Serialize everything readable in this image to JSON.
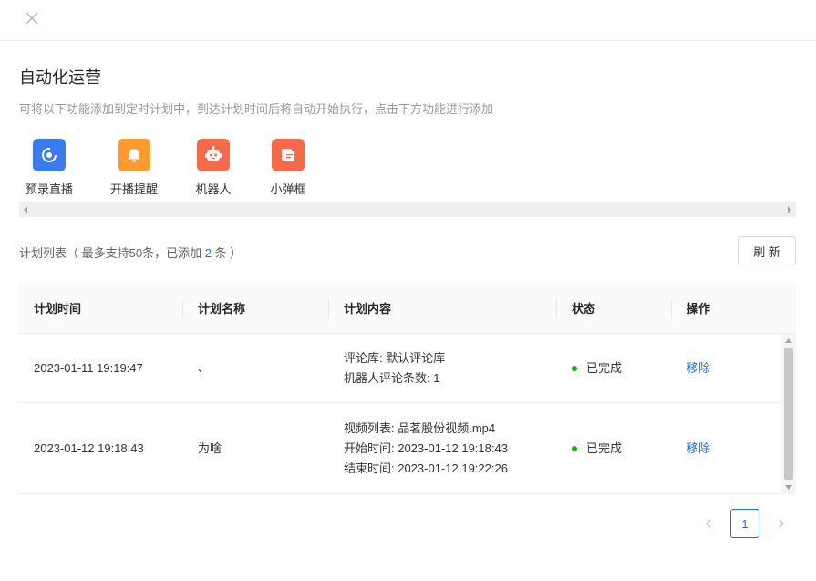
{
  "header": {
    "close_label": "×"
  },
  "section": {
    "title": "自动化运营",
    "subtitle": "可将以下功能添加到定时计划中，到达计划时间后将自动开始执行，点击下方功能进行添加"
  },
  "features": [
    {
      "label": "预录直播",
      "icon": "record-live-icon",
      "color": "#3a7cf0"
    },
    {
      "label": "开播提醒",
      "icon": "bell-icon",
      "color": "#ff9a2e"
    },
    {
      "label": "机器人",
      "icon": "robot-icon",
      "color": "#f56b4a"
    },
    {
      "label": "小弹框",
      "icon": "popup-icon",
      "color": "#f56b4a"
    }
  ],
  "plan": {
    "label_prefix": "计划列表（ 最多支持50条，已添加 ",
    "count": "2",
    "label_suffix": " 条 ）",
    "refresh_label": "刷 新"
  },
  "table": {
    "columns": [
      "计划时间",
      "计划名称",
      "计划内容",
      "状态",
      "操作"
    ],
    "rows": [
      {
        "time": "2023-01-11 19:19:47",
        "name": "、",
        "content": [
          "评论库: 默认评论库",
          "机器人评论条数: 1"
        ],
        "status": "已完成",
        "action": "移除"
      },
      {
        "time": "2023-01-12 19:18:43",
        "name": "为啥",
        "content": [
          "视频列表: 品茗股份视频.mp4",
          "开始时间: 2023-01-12 19:18:43",
          "结束时间: 2023-01-12 19:22:26"
        ],
        "status": "已完成",
        "action": "移除"
      }
    ]
  },
  "pagination": {
    "current": "1"
  },
  "colors": {
    "accent": "#1f6fe5",
    "status_done": "#1aad19"
  }
}
